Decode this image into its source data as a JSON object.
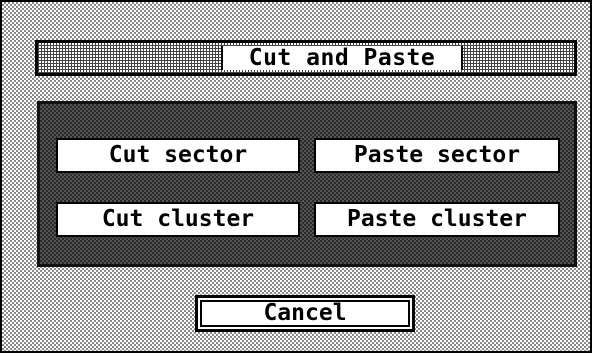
{
  "dialog": {
    "title": "Cut and Paste"
  },
  "actions": {
    "cut_sector": "Cut sector",
    "paste_sector": "Paste sector",
    "cut_cluster": "Cut cluster",
    "paste_cluster": "Paste cluster"
  },
  "footer": {
    "cancel_label": "Cancel"
  },
  "colors": {
    "foreground": "#000000",
    "background": "#ffffff",
    "panel": "#2a2a2a"
  }
}
